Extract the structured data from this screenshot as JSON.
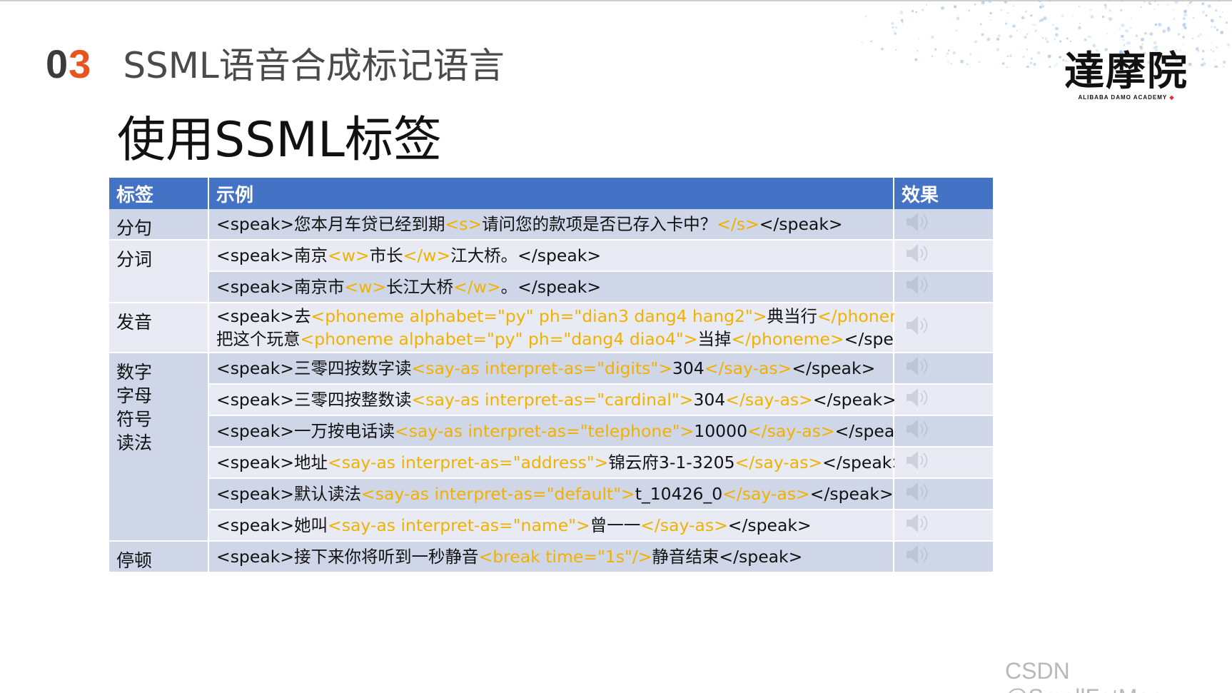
{
  "header": {
    "number_prefix": "0",
    "number_accent": "3",
    "section_title": "SSML语音合成标记语言",
    "subtitle": "使用SSML标签"
  },
  "logo": {
    "main": "達摩院",
    "sub": "ALIBABA DAMO ACADEMY"
  },
  "table": {
    "columns": [
      "标签",
      "示例",
      "效果"
    ],
    "groups": [
      {
        "tag": "分句",
        "shade": "dark",
        "rows": [
          {
            "shade": "dark",
            "lines": [
              [
                [
                  "<speak>您本月车贷已经到期",
                  false
                ],
                [
                  "<s>",
                  true
                ],
                [
                  "请问您的款项是否已存入卡中？",
                  false
                ],
                [
                  "</s>",
                  true
                ],
                [
                  "</speak>",
                  false
                ]
              ]
            ]
          }
        ]
      },
      {
        "tag": "分词",
        "shade": "light",
        "rows": [
          {
            "shade": "light",
            "lines": [
              [
                [
                  "<speak>南京",
                  false
                ],
                [
                  "<w>",
                  true
                ],
                [
                  "市长",
                  false
                ],
                [
                  "</w>",
                  true
                ],
                [
                  "江大桥。</speak>",
                  false
                ]
              ]
            ]
          },
          {
            "shade": "dark",
            "lines": [
              [
                [
                  "<speak>南京市",
                  false
                ],
                [
                  "<w>",
                  true
                ],
                [
                  "长江大桥",
                  false
                ],
                [
                  "</w>",
                  true
                ],
                [
                  "。</speak>",
                  false
                ]
              ]
            ]
          }
        ]
      },
      {
        "tag": "发音",
        "shade": "light",
        "rows": [
          {
            "shade": "light",
            "lines": [
              [
                [
                  "<speak>去",
                  false
                ],
                [
                  "<phoneme alphabet=\"py\" ph=\"dian3 dang4 hang2\">",
                  true
                ],
                [
                  "典当行",
                  false
                ],
                [
                  "</phoneme>",
                  true
                ]
              ],
              [
                [
                  "把这个玩意",
                  false
                ],
                [
                  "<phoneme alphabet=\"py\" ph=\"dang4 diao4\">",
                  true
                ],
                [
                  "当掉",
                  false
                ],
                [
                  "</phoneme>",
                  true
                ],
                [
                  "</speak>",
                  false
                ]
              ]
            ]
          }
        ]
      },
      {
        "tag": "数字\n字母\n符号\n读法",
        "shade": "dark",
        "rows": [
          {
            "shade": "dark",
            "lines": [
              [
                [
                  "<speak>三零四按数字读",
                  false
                ],
                [
                  "<say-as interpret-as=\"digits\">",
                  true
                ],
                [
                  "304",
                  false
                ],
                [
                  "</say-as>",
                  true
                ],
                [
                  "</speak>",
                  false
                ]
              ]
            ]
          },
          {
            "shade": "light",
            "lines": [
              [
                [
                  "<speak>三零四按整数读",
                  false
                ],
                [
                  "<say-as interpret-as=\"cardinal\">",
                  true
                ],
                [
                  "304",
                  false
                ],
                [
                  "</say-as>",
                  true
                ],
                [
                  "</speak>",
                  false
                ]
              ]
            ]
          },
          {
            "shade": "dark",
            "lines": [
              [
                [
                  "<speak>一万按电话读",
                  false
                ],
                [
                  "<say-as interpret-as=\"telephone\">",
                  true
                ],
                [
                  "10000",
                  false
                ],
                [
                  "</say-as>",
                  true
                ],
                [
                  "</speak>",
                  false
                ]
              ]
            ]
          },
          {
            "shade": "light",
            "lines": [
              [
                [
                  "<speak>地址",
                  false
                ],
                [
                  "<say-as interpret-as=\"address\">",
                  true
                ],
                [
                  "锦云府3-1-3205",
                  false
                ],
                [
                  "</say-as>",
                  true
                ],
                [
                  "</speak>",
                  false
                ]
              ]
            ]
          },
          {
            "shade": "dark",
            "lines": [
              [
                [
                  "<speak>默认读法",
                  false
                ],
                [
                  "<say-as interpret-as=\"default\">",
                  true
                ],
                [
                  "t_10426_0",
                  false
                ],
                [
                  "</say-as>",
                  true
                ],
                [
                  "</speak>",
                  false
                ]
              ]
            ]
          },
          {
            "shade": "light",
            "lines": [
              [
                [
                  "<speak>她叫",
                  false
                ],
                [
                  "<say-as interpret-as=\"name\">",
                  true
                ],
                [
                  "曾一一",
                  false
                ],
                [
                  "</say-as>",
                  true
                ],
                [
                  "</speak>",
                  false
                ]
              ]
            ]
          }
        ]
      },
      {
        "tag": "停顿",
        "shade": "dark",
        "rows": [
          {
            "shade": "dark",
            "lines": [
              [
                [
                  "<speak>接下来你将听到一秒静音",
                  false
                ],
                [
                  "<break time=\"1s\"/>",
                  true
                ],
                [
                  "静音结束</speak>",
                  false
                ]
              ]
            ]
          }
        ]
      }
    ]
  },
  "icons": {
    "effect": "speaker-icon"
  },
  "colors": {
    "header_bg": "#4472c4",
    "accent": "#e8531f",
    "highlight": "#f2b100",
    "row_dark": "#cfd6e8",
    "row_light": "#e8ebf4"
  },
  "watermark": "CSDN @SmallFatMan"
}
